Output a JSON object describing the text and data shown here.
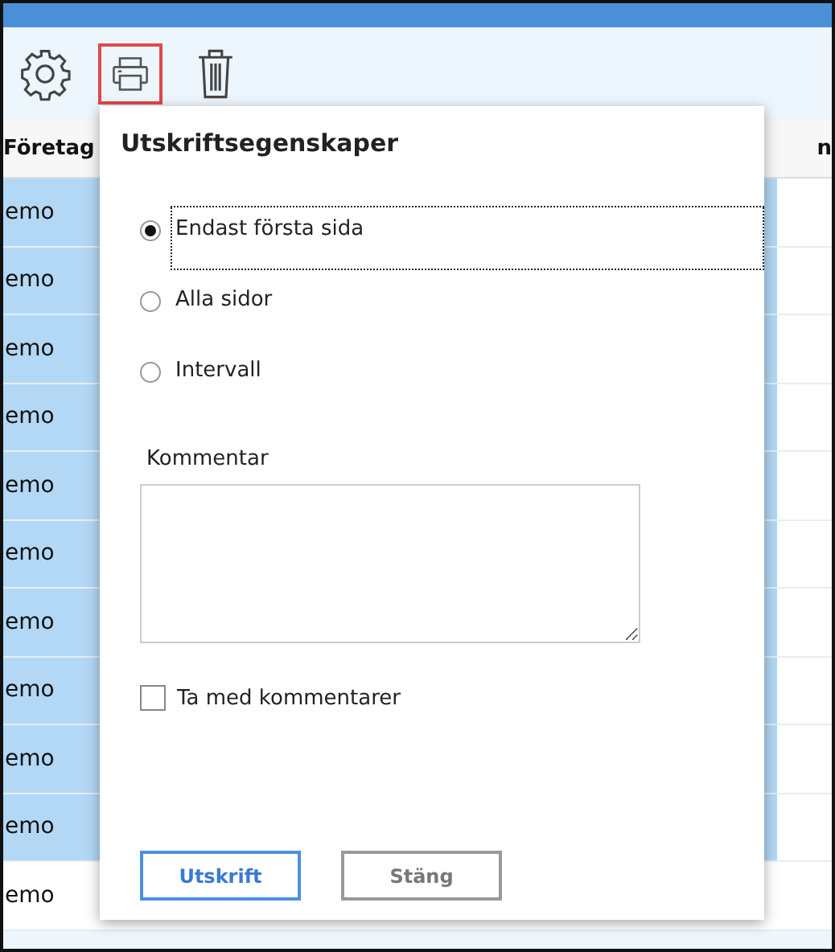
{
  "toolbar": [
    {
      "kind": "gear",
      "selected": false
    },
    {
      "kind": "printer",
      "selected": true
    },
    {
      "kind": "trash",
      "selected": false
    }
  ],
  "table": {
    "columns": [
      "Företag",
      "n"
    ],
    "rows": [
      {
        "cell": "emo",
        "selected": true
      },
      {
        "cell": "emo",
        "selected": true
      },
      {
        "cell": "emo",
        "selected": true
      },
      {
        "cell": "emo",
        "selected": true
      },
      {
        "cell": "emo",
        "selected": true
      },
      {
        "cell": "emo",
        "selected": true
      },
      {
        "cell": "emo",
        "selected": true
      },
      {
        "cell": "emo",
        "selected": true
      },
      {
        "cell": "emo",
        "selected": true
      },
      {
        "cell": "emo",
        "selected": true
      },
      {
        "cell": "emo",
        "selected": false
      }
    ]
  },
  "dialog": {
    "title": "Utskriftsegenskaper",
    "options": [
      {
        "label": "Endast första sida",
        "selected": true
      },
      {
        "label": "Alla sidor",
        "selected": false
      },
      {
        "label": "Intervall",
        "selected": false
      }
    ],
    "comment_label": "Kommentar",
    "include_comments": {
      "label": "Ta med kommentarer",
      "checked": false
    },
    "buttons": [
      {
        "label": "Utskrift",
        "kind": "primary"
      },
      {
        "label": "Stäng",
        "kind": "secondary"
      }
    ]
  }
}
